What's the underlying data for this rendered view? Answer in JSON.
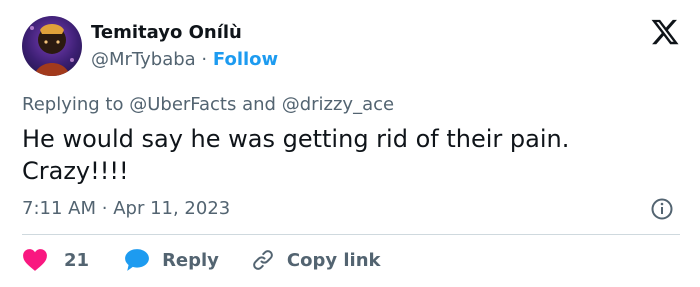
{
  "author": {
    "name": "Temitayo Onílù",
    "handle": "@MrTybaba",
    "separator": "·",
    "follow_label": "Follow"
  },
  "reply": {
    "prefix": "Replying to",
    "mention1": "@UberFacts",
    "conjunction": "and",
    "mention2": "@drizzy_ace"
  },
  "tweet": {
    "text": "He would say he was getting rid of their pain. Crazy!!!!",
    "time": "7:11 AM",
    "separator": "·",
    "date": "Apr 11, 2023"
  },
  "actions": {
    "likes": "21",
    "reply_label": "Reply",
    "copy_link_label": "Copy link"
  },
  "icons": {
    "logo": "x-logo-icon",
    "info": "info-icon",
    "like": "heart-icon",
    "reply": "speech-bubble-icon",
    "copy": "link-icon"
  },
  "colors": {
    "accent": "#1d9bf0",
    "like": "#f91880",
    "text": "#0f1419",
    "secondary": "#536471",
    "divider": "#cfd9de"
  }
}
